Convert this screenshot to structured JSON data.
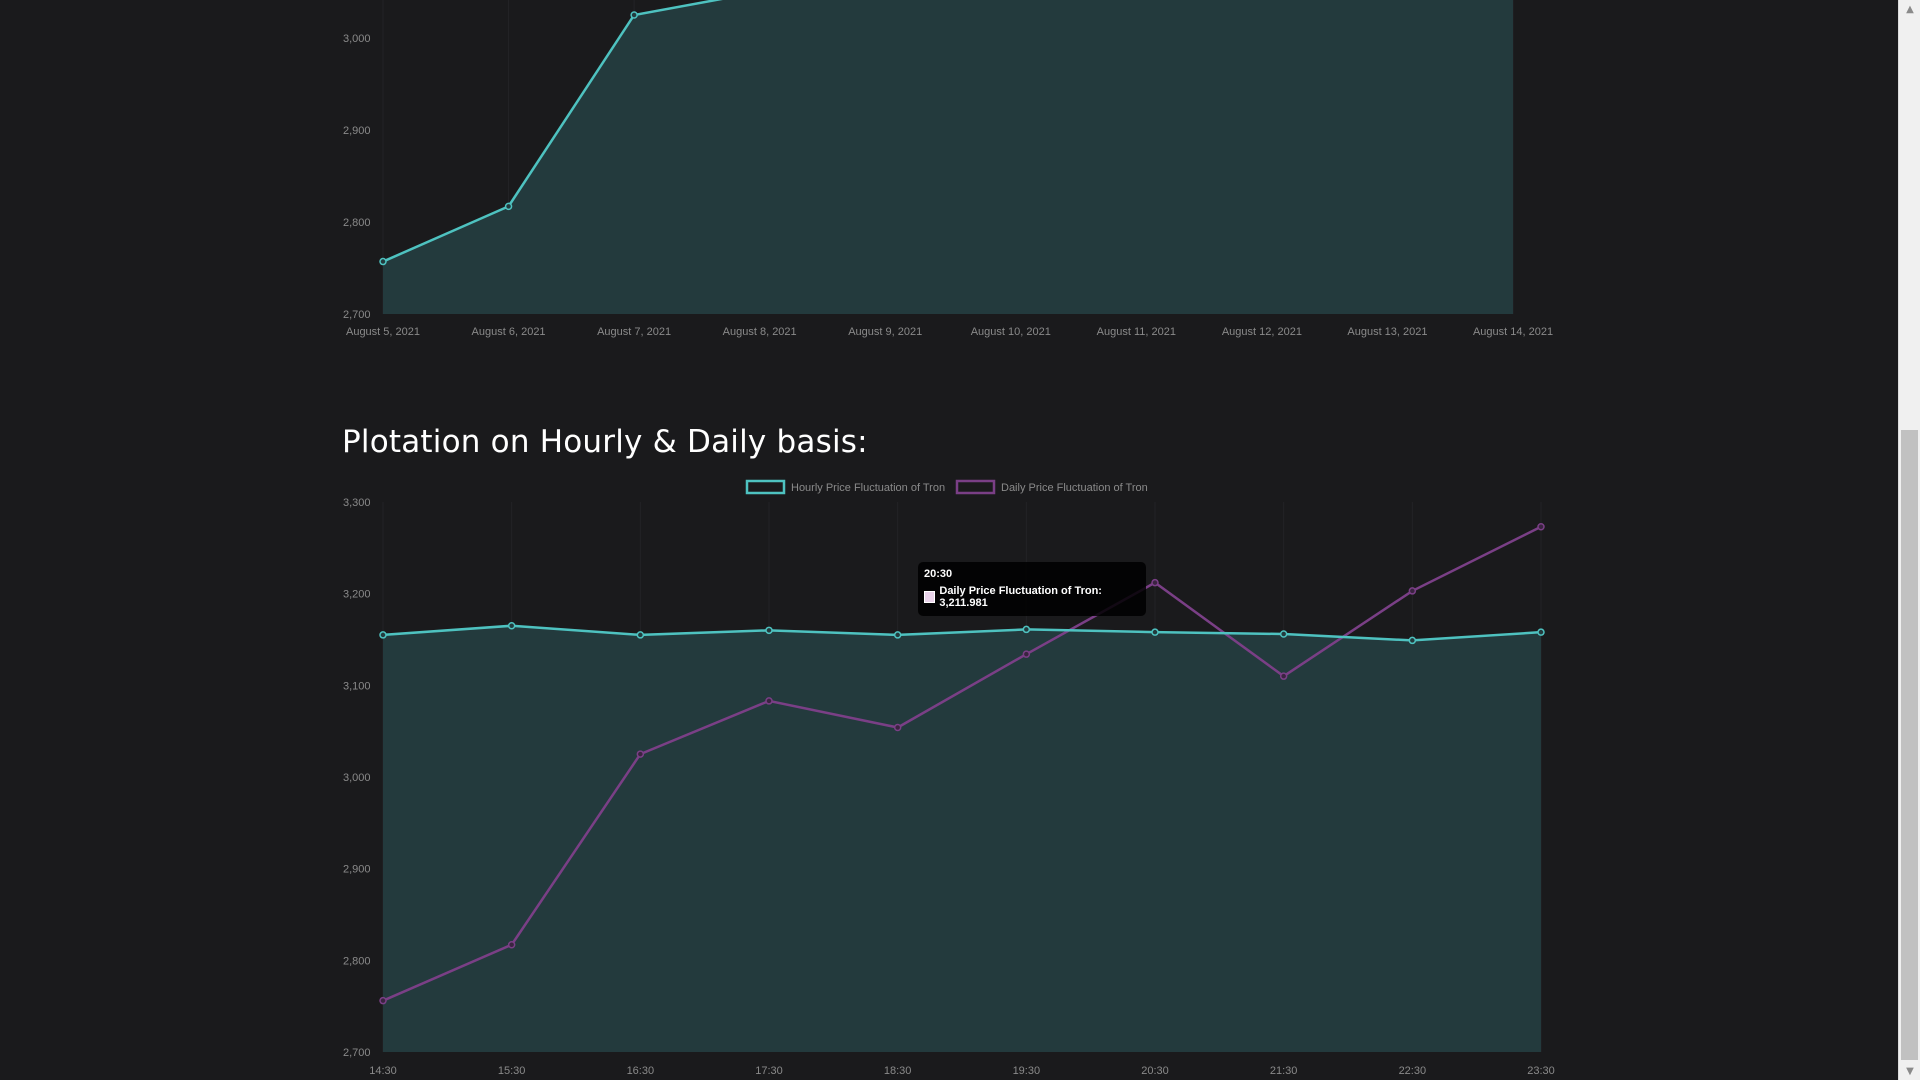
{
  "section": {
    "title": "Plotation on Hourly & Daily basis:"
  },
  "colors": {
    "teal": "#4ec2c0",
    "purple": "#7a3f86",
    "fill": "#233a3d",
    "background": "#1a1a1c"
  },
  "tooltip": {
    "title": "20:30",
    "body": "Daily Price Fluctuation of Tron: 3,211.981"
  },
  "chart_data": [
    {
      "type": "area",
      "title": "",
      "xlabel": "",
      "ylabel": "",
      "categories": [
        "August 5, 2021",
        "August 6, 2021",
        "August 7, 2021",
        "August 8, 2021",
        "August 9, 2021",
        "August 10, 2021",
        "August 11, 2021",
        "August 12, 2021",
        "August 13, 2021",
        "August 14, 2021"
      ],
      "y_ticks": [
        "2,700",
        "2,800",
        "2,900",
        "3,000"
      ],
      "ylim": [
        2700,
        3040
      ],
      "grid": false,
      "series": [
        {
          "values": [
            2757,
            2817,
            3025,
            3050,
            null,
            null,
            null,
            null,
            null,
            null
          ]
        }
      ]
    },
    {
      "type": "line",
      "title": "",
      "xlabel": "",
      "ylabel": "",
      "categories": [
        "14:30",
        "15:30",
        "16:30",
        "17:30",
        "18:30",
        "19:30",
        "20:30",
        "21:30",
        "22:30",
        "23:30"
      ],
      "y_ticks": [
        "2,700",
        "2,800",
        "2,900",
        "3,000",
        "3,100",
        "3,200",
        "3,300"
      ],
      "ylim": [
        2700,
        3300
      ],
      "grid": false,
      "legend_position": "top-center",
      "series": [
        {
          "name": "Hourly Price Fluctuation of Tron",
          "values": [
            3155,
            3165,
            3155,
            3160,
            3155,
            3161,
            3158,
            3156,
            3149,
            3158
          ]
        },
        {
          "name": "Daily Price Fluctuation of Tron",
          "values": [
            2756,
            2817,
            3025,
            3083,
            3054,
            3134,
            3212,
            3110,
            3203,
            3273
          ]
        }
      ]
    }
  ]
}
